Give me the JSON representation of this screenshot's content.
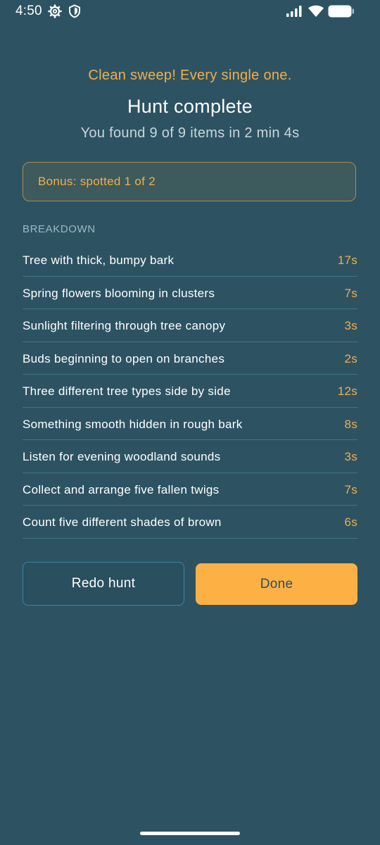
{
  "status_bar": {
    "time": "4:50",
    "icons": [
      "gear-icon",
      "shield-icon",
      "signal-icon",
      "wifi-icon",
      "battery-icon"
    ]
  },
  "header": {
    "tagline": "Clean sweep! Every single one.",
    "title": "Hunt complete",
    "subtitle": "You found 9 of 9 items in 2 min 4s"
  },
  "bonus": {
    "text": "Bonus: spotted 1 of 2"
  },
  "breakdown": {
    "label": "BREAKDOWN",
    "items": [
      {
        "label": "Tree with thick, bumpy bark",
        "time": "17s"
      },
      {
        "label": "Spring flowers blooming in clusters",
        "time": "7s"
      },
      {
        "label": "Sunlight filtering through tree canopy",
        "time": "3s"
      },
      {
        "label": "Buds beginning to open on branches",
        "time": "2s"
      },
      {
        "label": "Three different tree types side by side",
        "time": "12s"
      },
      {
        "label": "Something smooth hidden in rough bark",
        "time": "8s"
      },
      {
        "label": "Listen for evening woodland sounds",
        "time": "3s"
      },
      {
        "label": "Collect and arrange five fallen twigs",
        "time": "7s"
      },
      {
        "label": "Count five different shades of brown",
        "time": "6s"
      }
    ]
  },
  "actions": {
    "redo_label": "Redo hunt",
    "done_label": "Done"
  },
  "colors": {
    "background": "#2d5363",
    "accent": "#f5ae45",
    "done_button": "#fdb145",
    "divider": "#3f7388"
  }
}
